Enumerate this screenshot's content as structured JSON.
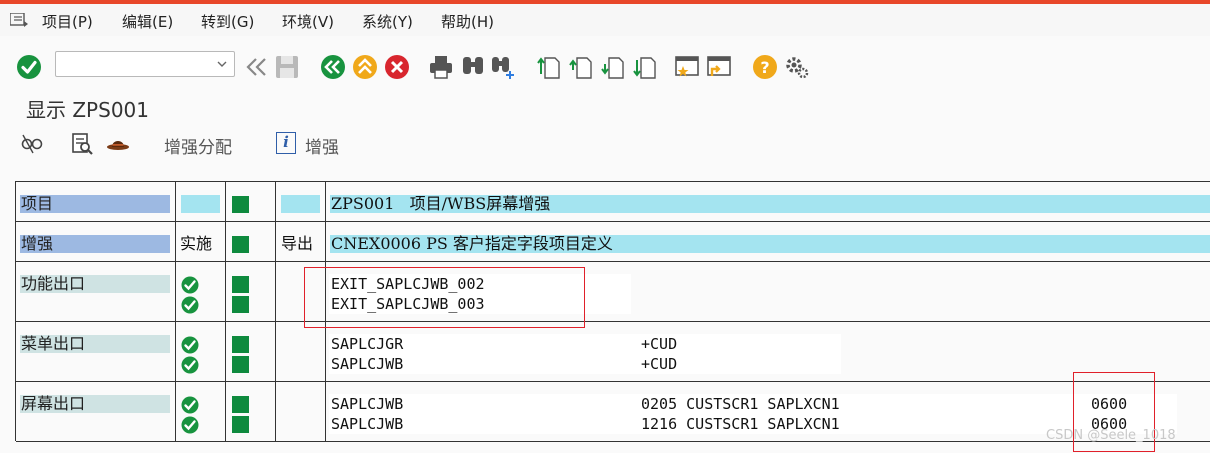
{
  "menu": {
    "items": [
      "项目(P)",
      "编辑(E)",
      "转到(G)",
      "环境(V)",
      "系统(Y)",
      "帮助(H)"
    ]
  },
  "toolbar": {
    "command_value": "",
    "icons": [
      "enter-check",
      "back-double-arrow",
      "save-disk",
      "back-green",
      "exit-up",
      "cancel-red",
      "print",
      "find",
      "find-next",
      "first-page",
      "previous-page",
      "next-page",
      "last-page",
      "create-session",
      "shortcut",
      "help",
      "customize-layout"
    ]
  },
  "title": "显示 ZPS001",
  "app_toolbar": {
    "assign_label": "增强分配",
    "enhance_label": "增强",
    "info_glyph": "i"
  },
  "grid": {
    "project_label": "项目",
    "project_value": "ZPS001   项目/WBS屏幕增强",
    "enhancement_label": "增强",
    "enhancement_impl": "实施",
    "enhancement_export": "导出",
    "enhancement_value": "CNEX0006 PS 客户指定字段项目定义",
    "function_exits_label": "功能出口",
    "function_exits": [
      "EXIT_SAPLCJWB_002",
      "EXIT_SAPLCJWB_003"
    ],
    "menu_exits_label": "菜单出口",
    "menu_exits": [
      {
        "program": "SAPLCJGR",
        "code": "+CUD"
      },
      {
        "program": "SAPLCJWB",
        "code": "+CUD"
      }
    ],
    "screen_exits_label": "屏幕出口",
    "screen_exits": [
      {
        "program": "SAPLCJWB",
        "detail": "0205 CUSTSCR1 SAPLXCN1",
        "screen": "0600"
      },
      {
        "program": "SAPLCJWB",
        "detail": "1216 CUSTSCR1 SAPLXCN1",
        "screen": "0600"
      }
    ]
  },
  "watermark": "CSDN @Seele_1018",
  "colors": {
    "accent_top": "#e8472a",
    "status_green": "#0e8a3e",
    "label_blue": "#9db9e2",
    "cell_cyan": "#a4e4f0",
    "highlight_red": "#e0202a"
  }
}
